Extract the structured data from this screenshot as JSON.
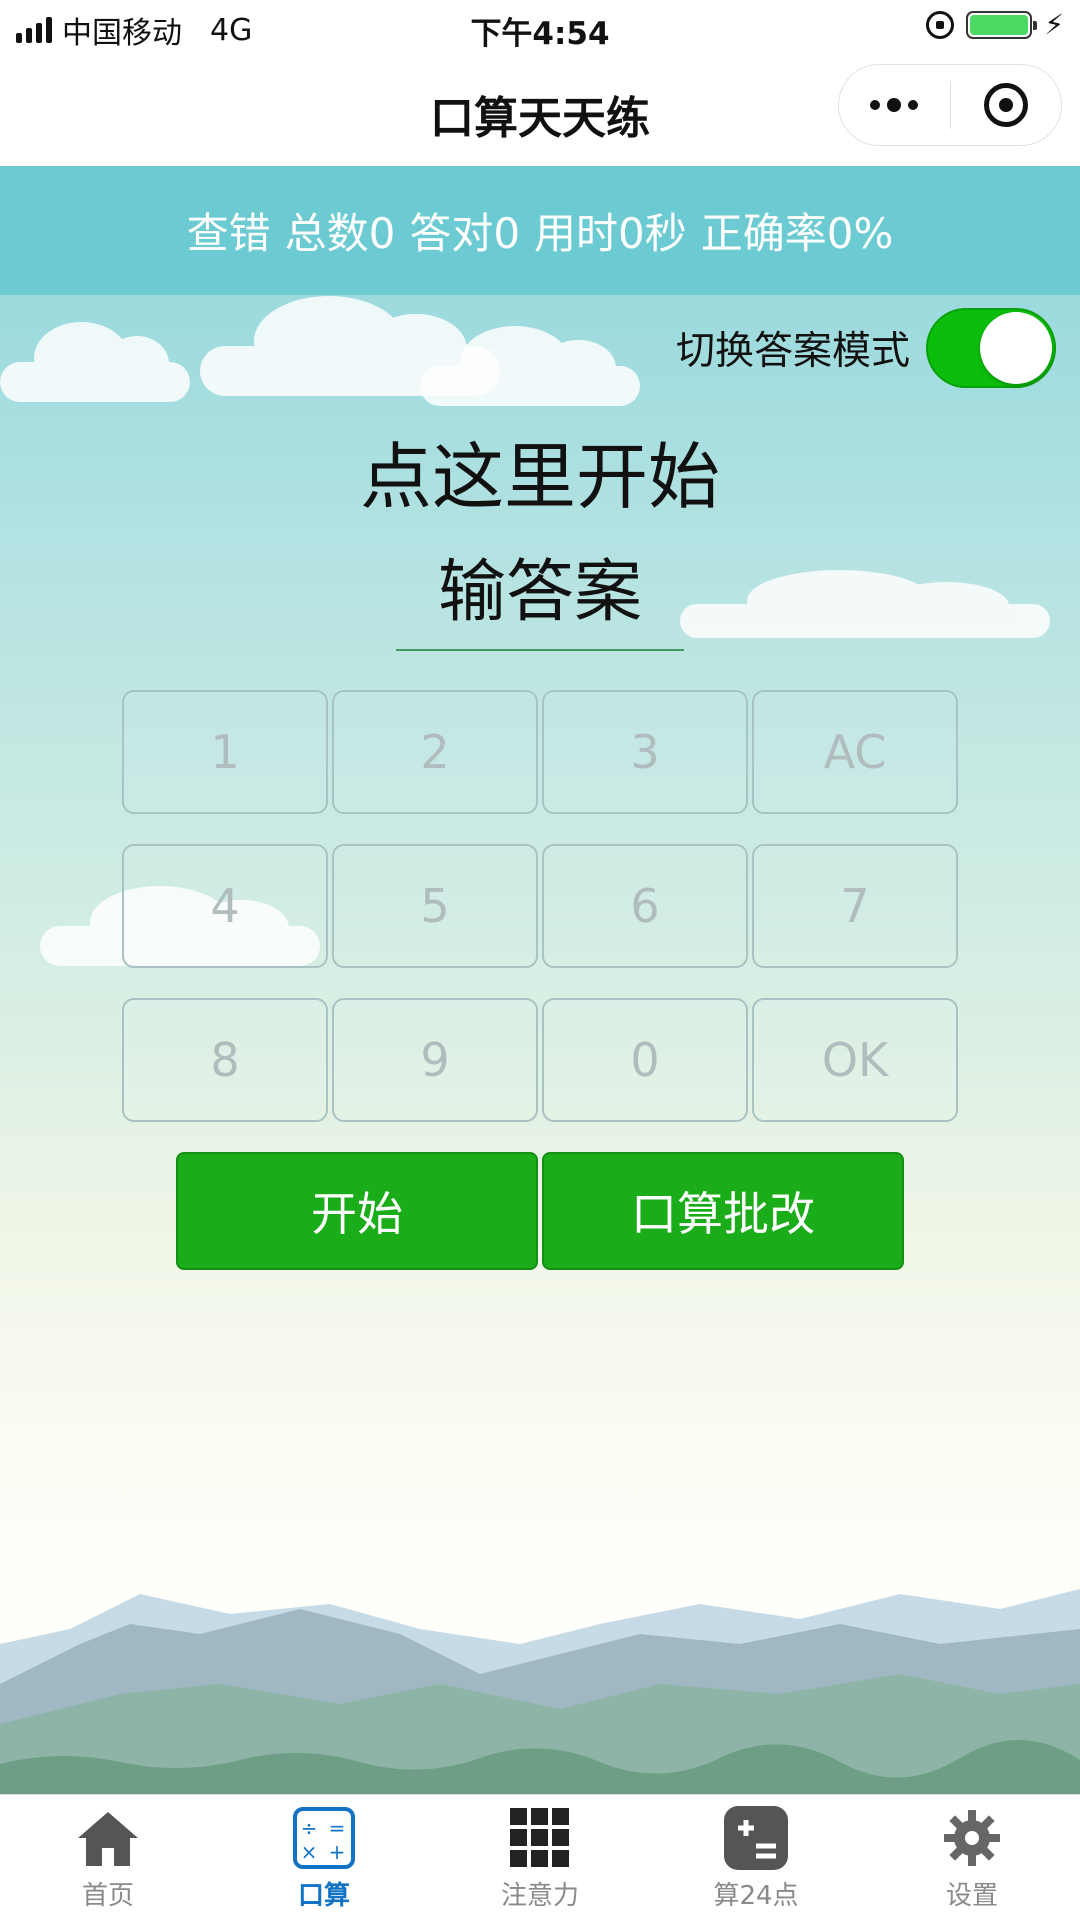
{
  "status_bar": {
    "carrier": "中国移动",
    "network": "4G",
    "time": "下午4:54"
  },
  "nav": {
    "title": "口算天天练"
  },
  "stats": {
    "check_errors": "查错",
    "total": "总数0",
    "correct": "答对0",
    "time_used": "用时0秒",
    "accuracy": "正确率0%"
  },
  "mode_toggle": {
    "label": "切换答案模式",
    "on": true,
    "color": "#0bbe0b"
  },
  "main": {
    "start_hint": "点这里开始",
    "answer_placeholder": "输答案"
  },
  "keypad": {
    "keys": [
      "1",
      "2",
      "3",
      "AC",
      "4",
      "5",
      "6",
      "7",
      "8",
      "9",
      "0",
      "OK"
    ]
  },
  "actions": {
    "start": "开始",
    "grade": "口算批改",
    "color": "#1aad19"
  },
  "tabbar": {
    "items": [
      {
        "label": "首页",
        "icon": "home-icon",
        "active": false
      },
      {
        "label": "口算",
        "icon": "calculator-icon",
        "active": true
      },
      {
        "label": "注意力",
        "icon": "grid-icon",
        "active": false
      },
      {
        "label": "算24点",
        "icon": "plus-equals-icon",
        "active": false
      },
      {
        "label": "设置",
        "icon": "gear-icon",
        "active": false
      }
    ],
    "active_color": "#1273c4"
  }
}
